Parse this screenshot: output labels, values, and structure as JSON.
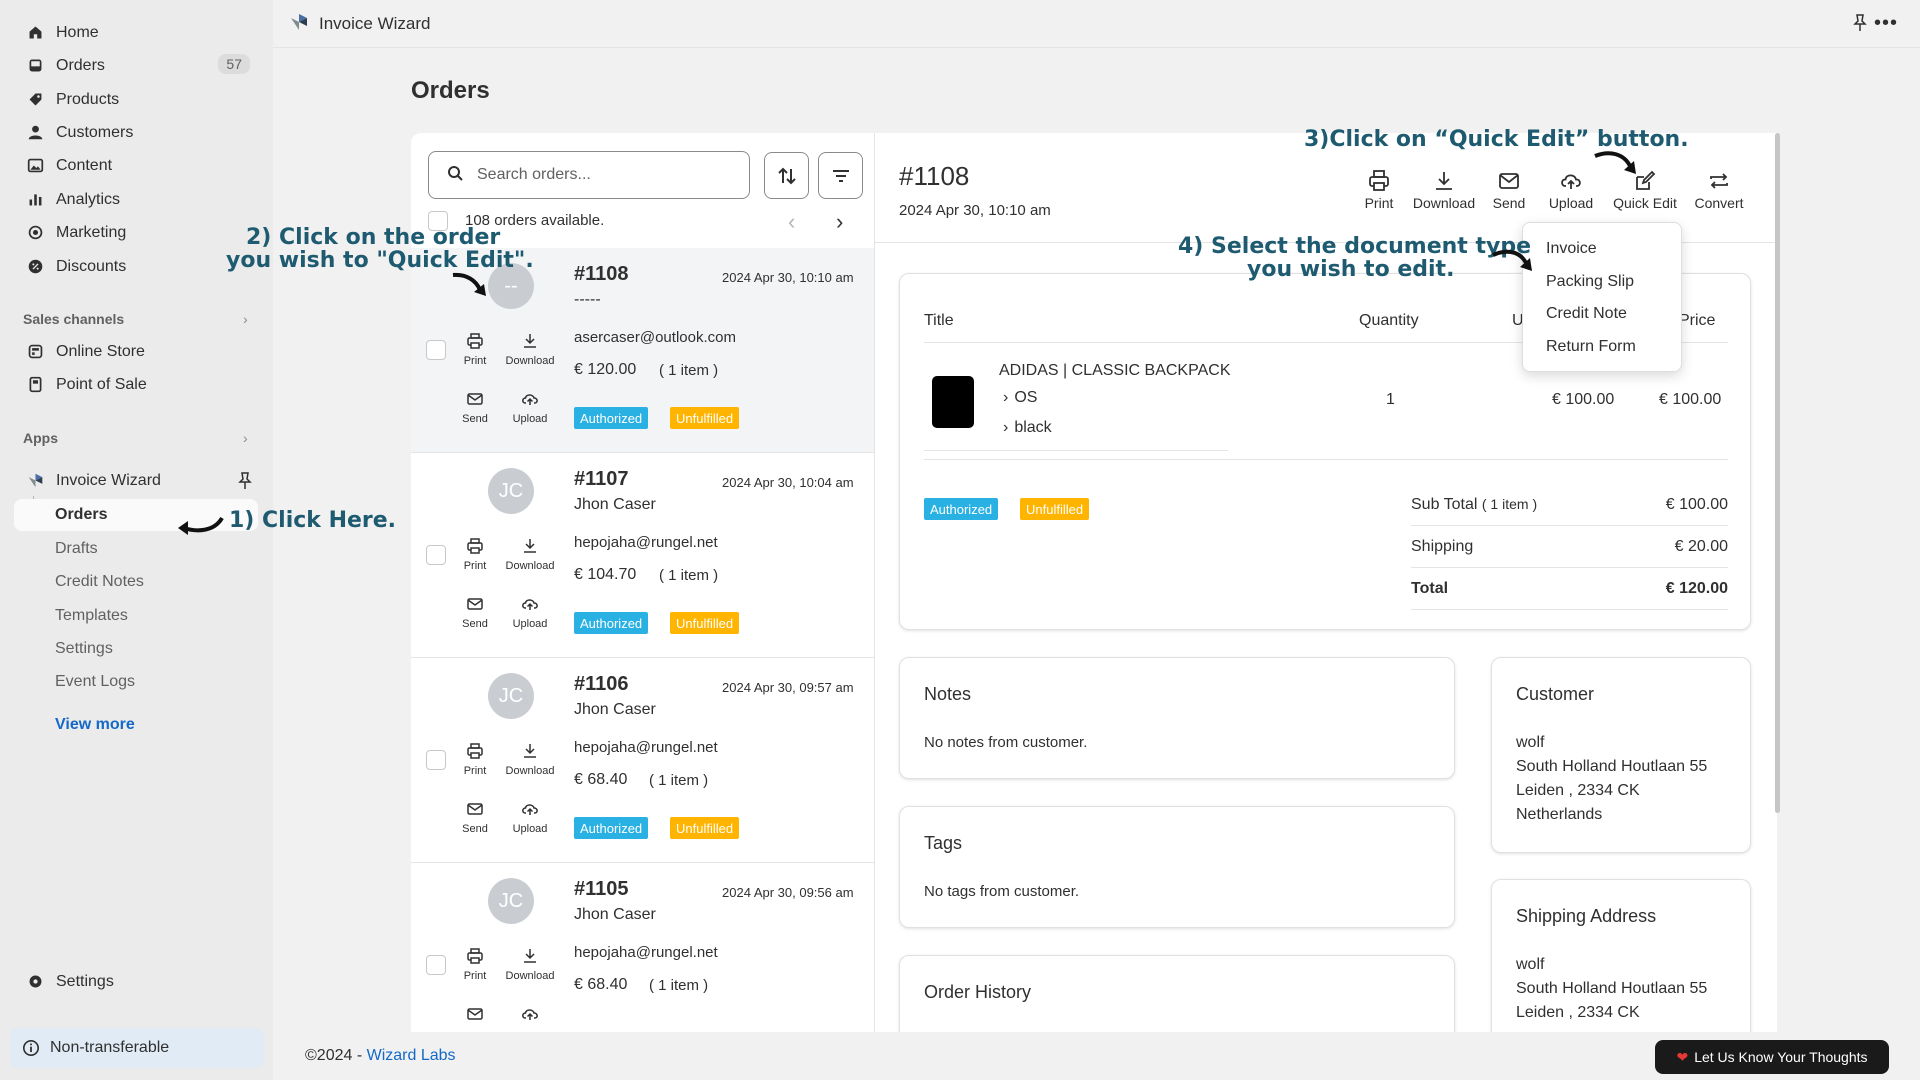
{
  "sidebar": {
    "nav": [
      {
        "label": "Home",
        "icon": "home-icon"
      },
      {
        "label": "Orders",
        "icon": "inbox-icon",
        "badge": "57"
      },
      {
        "label": "Products",
        "icon": "tag-icon"
      },
      {
        "label": "Customers",
        "icon": "person-icon"
      },
      {
        "label": "Content",
        "icon": "image-icon"
      },
      {
        "label": "Analytics",
        "icon": "bar-chart-icon"
      },
      {
        "label": "Marketing",
        "icon": "target-icon"
      },
      {
        "label": "Discounts",
        "icon": "discount-icon"
      }
    ],
    "sales_channels_title": "Sales channels",
    "sales_channels": [
      {
        "label": "Online Store",
        "icon": "store-icon"
      },
      {
        "label": "Point of Sale",
        "icon": "pos-icon"
      }
    ],
    "apps_title": "Apps",
    "app": {
      "label": "Invoice Wizard",
      "icon": "app-logo-icon"
    },
    "app_sub": {
      "active": "Orders",
      "items": [
        "Drafts",
        "Credit Notes",
        "Templates",
        "Settings",
        "Event Logs"
      ]
    },
    "view_more": "View more",
    "settings": "Settings",
    "non_transferable": "Non-transferable"
  },
  "topbar": {
    "title": "Invoice Wizard"
  },
  "page": {
    "title": "Orders"
  },
  "list": {
    "search_placeholder": "Search orders...",
    "available": "108 orders available.",
    "orders": [
      {
        "avatar": "--",
        "number": "#1108",
        "date": "2024 Apr 30, 10:10 am",
        "name": "-----",
        "email": "asercaser@outlook.com",
        "amount": "€ 120.00",
        "items": "( 1 item )",
        "status": [
          "Authorized",
          "Unfulfilled"
        ]
      },
      {
        "avatar": "JC",
        "number": "#1107",
        "date": "2024 Apr 30, 10:04 am",
        "name": "Jhon Caser",
        "email": "hepojaha@rungel.net",
        "amount": "€ 104.70",
        "items": "( 1 item )",
        "status": [
          "Authorized",
          "Unfulfilled"
        ]
      },
      {
        "avatar": "JC",
        "number": "#1106",
        "date": "2024 Apr 30, 09:57 am",
        "name": "Jhon Caser",
        "email": "hepojaha@rungel.net",
        "amount": "€ 68.40",
        "items": "( 1 item )",
        "status": [
          "Authorized",
          "Unfulfilled"
        ]
      },
      {
        "avatar": "JC",
        "number": "#1105",
        "date": "2024 Apr 30, 09:56 am",
        "name": "Jhon Caser",
        "email": "hepojaha@rungel.net",
        "amount": "€ 68.40",
        "items": "( 1 item )",
        "status": [
          "Authorized",
          "Unfulfilled"
        ]
      }
    ],
    "actions": {
      "print": "Print",
      "download": "Download",
      "send": "Send",
      "upload": "Upload"
    }
  },
  "detail": {
    "number": "#1108",
    "date": "2024 Apr 30, 10:10 am",
    "toolbar": [
      "Print",
      "Download",
      "Send",
      "Upload",
      "Quick Edit",
      "Convert"
    ],
    "dropdown": [
      "Invoice",
      "Packing Slip",
      "Credit Note",
      "Return Form"
    ],
    "table": {
      "headers": [
        "Title",
        "Quantity",
        "U",
        "l Price"
      ],
      "product": "ADIDAS | CLASSIC BACKPACK",
      "variants": [
        "OS",
        "black"
      ],
      "quantity": "1",
      "unit_price": "€ 100.00",
      "total_price": "€ 100.00"
    },
    "status": [
      "Authorized",
      "Unfulfilled"
    ],
    "summary": {
      "subtotal_label": "Sub Total",
      "subtotal_items": "( 1 item )",
      "subtotal": "€ 100.00",
      "shipping_label": "Shipping",
      "shipping": "€ 20.00",
      "total_label": "Total",
      "total": "€ 120.00"
    },
    "notes": {
      "title": "Notes",
      "text": "No notes from customer."
    },
    "tags": {
      "title": "Tags",
      "text": "No tags from customer."
    },
    "history": {
      "title": "Order History"
    },
    "customer": {
      "title": "Customer",
      "lines": [
        "wolf",
        "South Holland Houtlaan 55",
        "Leiden , 2334 CK",
        "Netherlands"
      ]
    },
    "shipping_address": {
      "title": "Shipping Address",
      "lines": [
        "wolf",
        "South Holland Houtlaan 55",
        "Leiden , 2334 CK"
      ]
    }
  },
  "annotations": {
    "step1": "1) Click Here.",
    "step2_l1": "2) Click on the order",
    "step2_l2": "you wish to \"Quick Edit\".",
    "step3": "3)Click on “Quick Edit” button.",
    "step4_l1": "4) Select the document type",
    "step4_l2": "you wish to edit."
  },
  "footer": {
    "copyright": "©2024 - ",
    "company": "Wizard Labs",
    "feedback": "Let Us Know Your Thoughts"
  },
  "colors": {
    "authorized": "#29b1e3",
    "unfulfilled": "#ffb400",
    "annotation": "#1f5b70",
    "link": "#1469c8"
  }
}
